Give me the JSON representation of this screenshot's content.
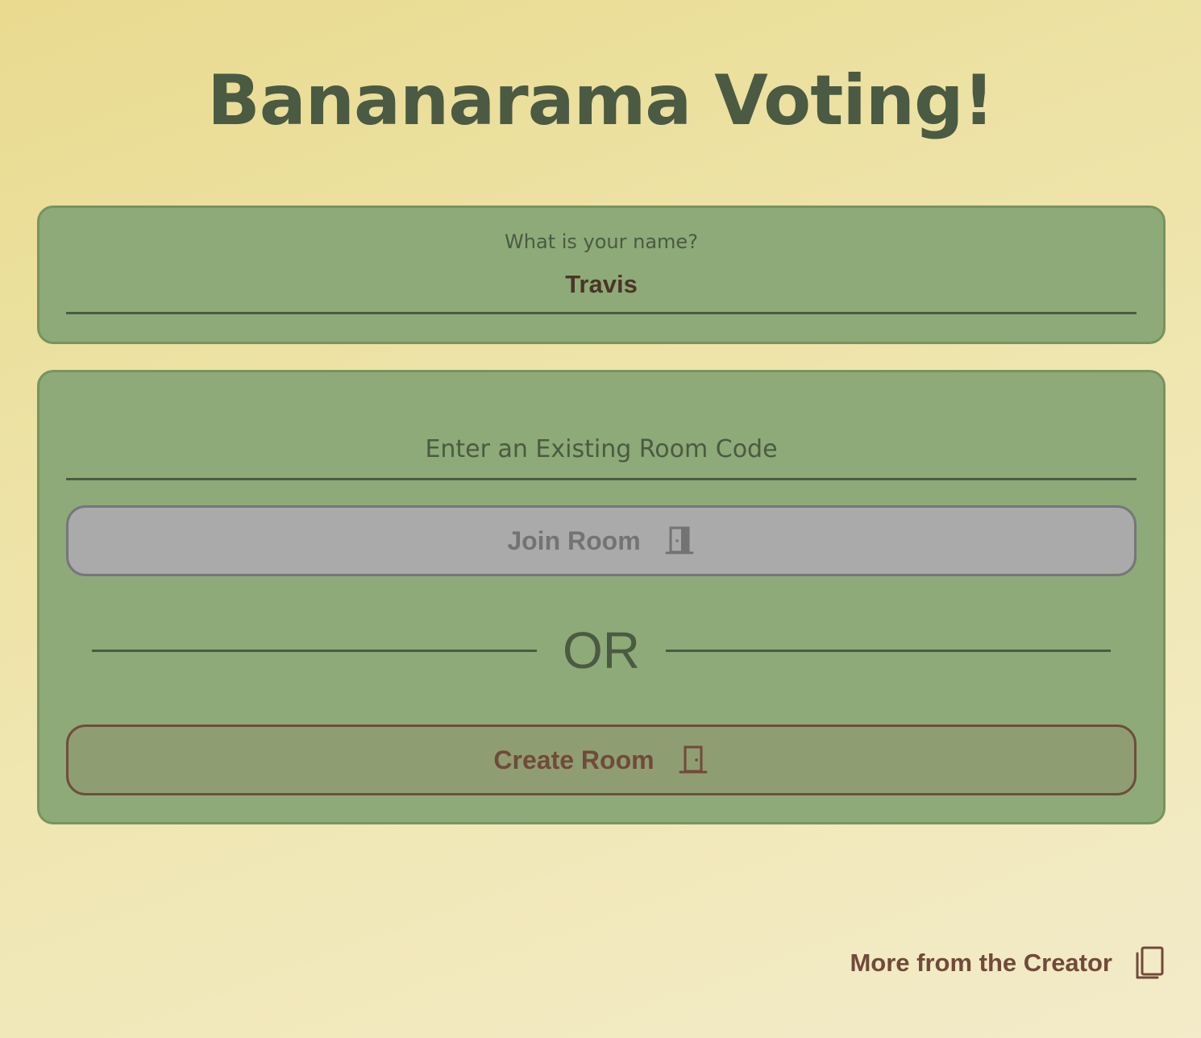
{
  "header": {
    "title": "Bananarama Voting!"
  },
  "name_card": {
    "label": "What is your name?",
    "value": "Travis"
  },
  "room_card": {
    "code_placeholder": "Enter an Existing Room Code",
    "join_label": "Join Room",
    "join_icon": "door-icon",
    "divider_text": "OR",
    "create_label": "Create Room",
    "create_icon": "door-open-icon"
  },
  "footer": {
    "link_label": "More from the Creator",
    "link_icon": "copy-icon"
  },
  "colors": {
    "background": "#ede3a6",
    "card": "#8daa78",
    "title": "#4b5a42",
    "accent_brown": "#704a3a",
    "disabled_gray": "#aaaaaa"
  }
}
